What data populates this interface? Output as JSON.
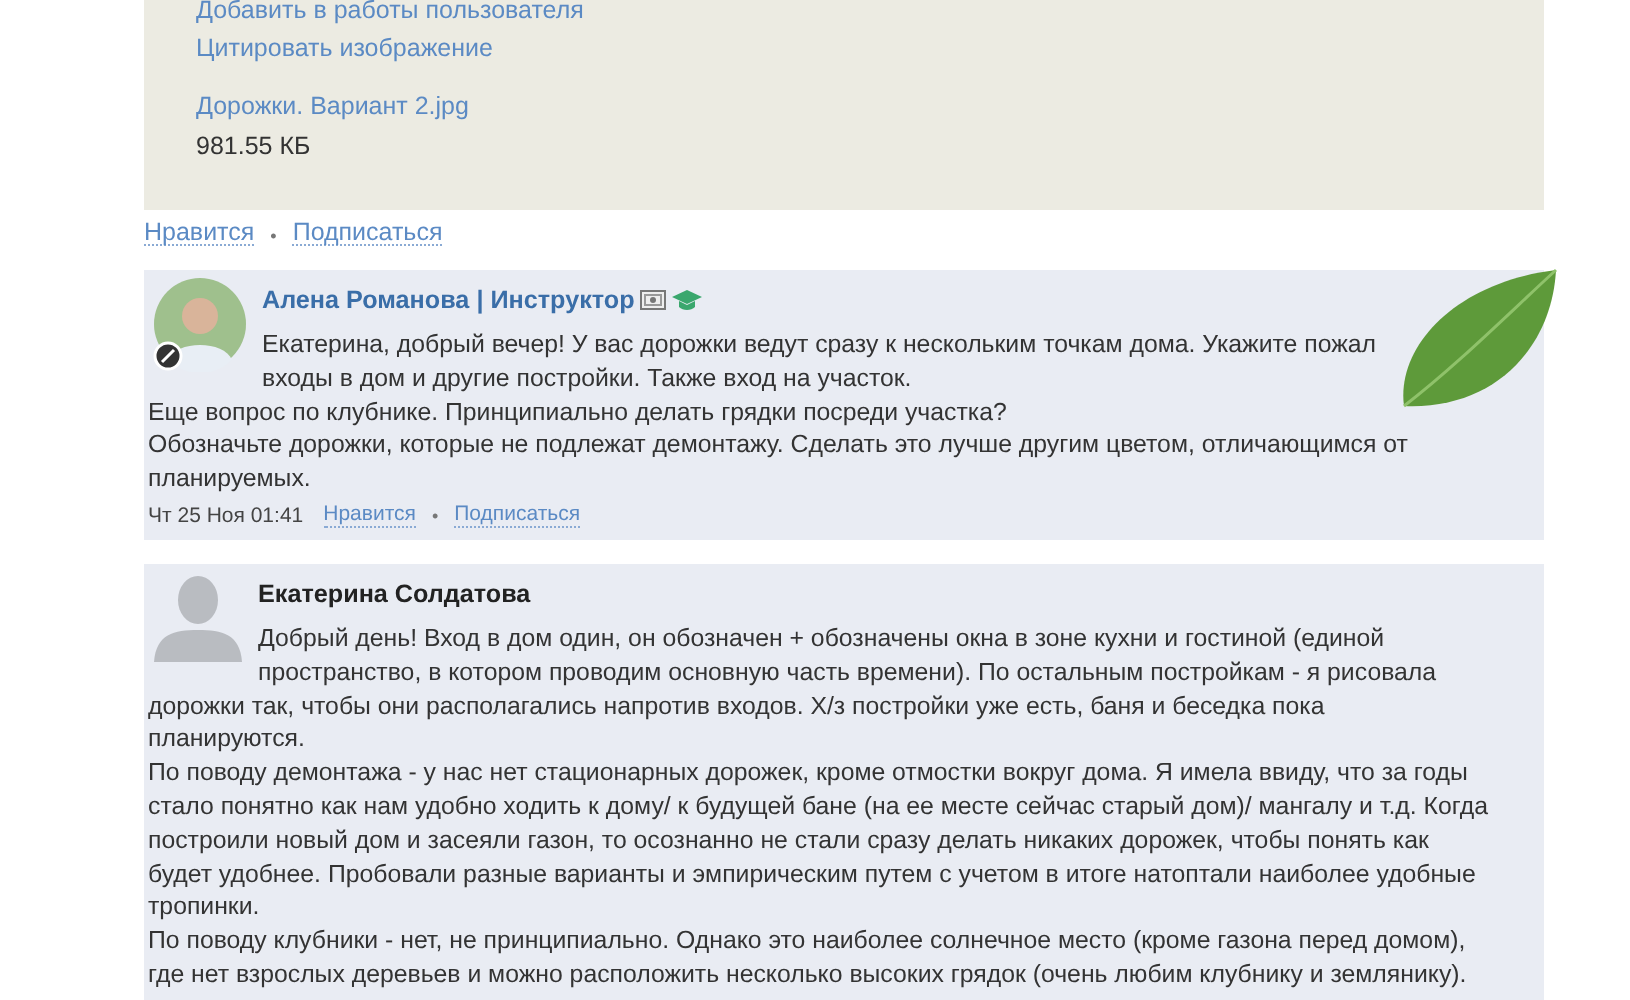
{
  "attachment": {
    "links": [
      "Добавить в работы пользователя",
      "Цитировать изображение"
    ],
    "file_name": "Дорожки. Вариант 2.jpg",
    "file_size": "981.55 КБ",
    "actions": [
      "Нравится",
      "Подписаться"
    ],
    "separator": "•"
  },
  "comments": [
    {
      "author": "Алена Романова | Инструктор",
      "avatar": {
        "kind": "photo"
      },
      "badges": [
        {
          "kind": "certificate"
        },
        {
          "kind": "graduate"
        }
      ],
      "lines": [
        "Екатерина, добрый вечер! У вас дорожки ведут сразу к нескольким точкам дома. Укажите пожал",
        "входы в дом и другие постройки. Также вход на участок.",
        "Еще вопрос по клубнике. Принципиально делать грядки посреди участка?",
        "Обозначьте дорожки, которые не подлежат демонтажу. Сделать это лучше другим цветом, отличающимся от",
        "планируемых."
      ],
      "date": "Чт 25 Ноя 01:41",
      "actions": [
        "Нравится",
        "Подписаться"
      ],
      "separator": "•",
      "decoration": {
        "kind": "leaf"
      }
    },
    {
      "author": "Екатерина Солдатова",
      "avatar": {
        "kind": "silhouette"
      },
      "lines": [
        "Добрый день! Вход в дом один, он обозначен + обозначены окна в зоне кухни и гостиной (единой",
        "пространство, в котором проводим основную часть времени). По остальным постройкам - я рисовала",
        "дорожки так, чтобы они располагались напротив входов. Х/з постройки уже есть, баня и беседка пока",
        "планируются.",
        "По поводу демонтажа - у нас нет стационарных дорожек, кроме отмостки вокруг дома. Я имела ввиду, что за годы",
        "стало понятно как нам удобно ходить к дому/ к будущей бане (на ее месте сейчас старый дом)/ мангалу и т.д. Когда",
        "построили новый дом и засеяли газон, то осознанно не стали сразу делать никаких дорожек, чтобы понять как",
        "будет удобнее. Пробовали разные варианты и эмпирическим путем с учетом в итоге натоптали наиболее удобные",
        "тропинки.",
        "По поводу клубники - нет, не принципиально. Однако это наиболее солнечное место (кроме газона перед домом),",
        "где нет взрослых деревьев и можно расположить несколько высоких грядок (очень любим клубнику и землянику)."
      ]
    }
  ]
}
